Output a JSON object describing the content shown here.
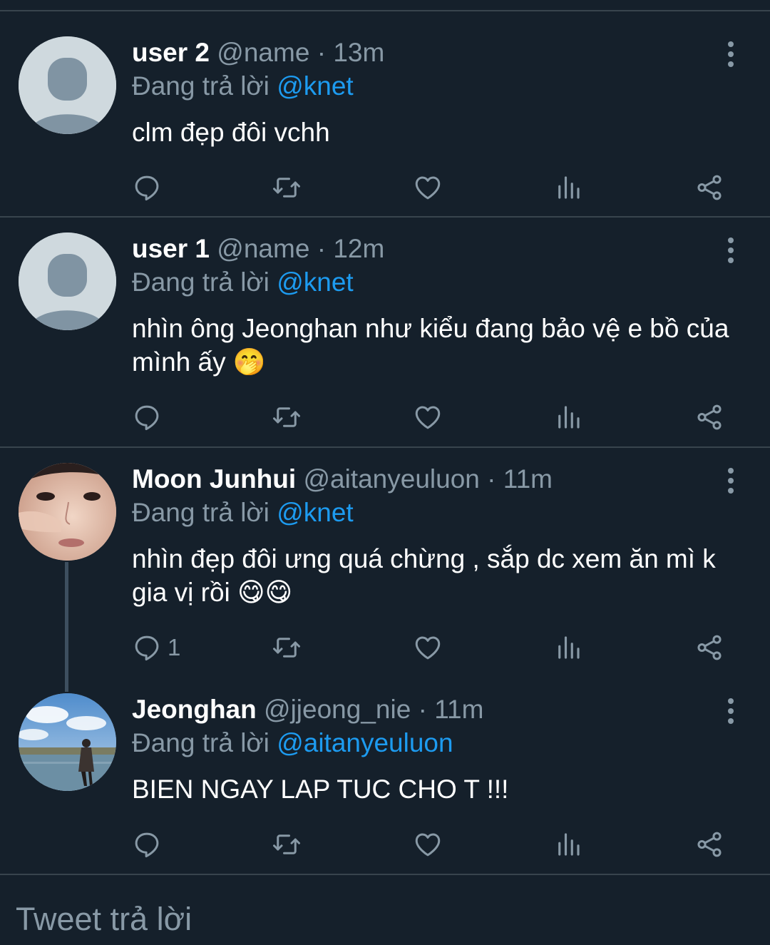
{
  "tweets": [
    {
      "name": "user 2",
      "handle": "@name",
      "dot": "·",
      "time": "13m",
      "reply_prefix": "Đang trả lời ",
      "reply_to": "@knet",
      "text": "clm đẹp đôi vchh",
      "reply_count": ""
    },
    {
      "name": "user 1",
      "handle": "@name",
      "dot": "·",
      "time": "12m",
      "reply_prefix": "Đang trả lời ",
      "reply_to": "@knet",
      "text": "nhìn ông Jeonghan như kiểu đang bảo vệ e bồ của mình ấy 🤭",
      "reply_count": ""
    },
    {
      "name": "Moon Junhui",
      "handle": "@aitanyeuluon",
      "dot": "·",
      "time": "11m",
      "reply_prefix": "Đang trả lời ",
      "reply_to": "@knet",
      "text": "nhìn đẹp đôi ưng quá chừng , sắp dc xem ăn mì k gia vị rồi 😋😋",
      "reply_count": "1"
    },
    {
      "name": "Jeonghan",
      "handle": "@jjeong_nie",
      "dot": "·",
      "time": "11m",
      "reply_prefix": "Đang trả lời ",
      "reply_to": "@aitanyeuluon",
      "text": "BIEN NGAY LAP TUC CHO T !!!",
      "reply_count": ""
    }
  ],
  "composer": {
    "placeholder": "Tweet trả lời"
  },
  "icons": {
    "reply": "reply-icon",
    "retweet": "retweet-icon",
    "like": "heart-icon",
    "analytics": "analytics-icon",
    "share": "share-icon",
    "menu": "more-vertical-icon"
  },
  "colors": {
    "background": "#15202b",
    "accent": "#1d9bf0",
    "secondary_text": "#8899a6",
    "divider": "#38444d"
  }
}
